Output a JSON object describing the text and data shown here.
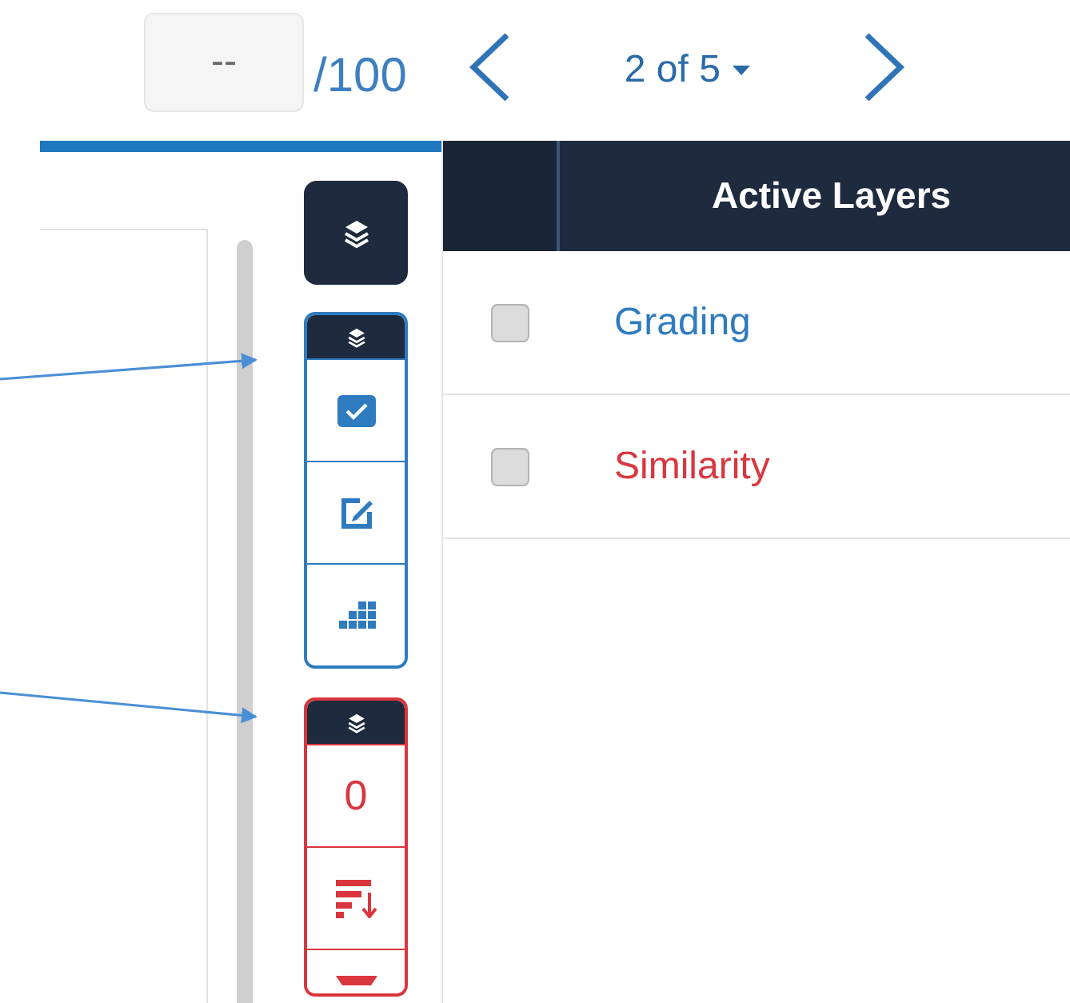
{
  "score": {
    "value": "--",
    "total": "/100"
  },
  "pager": {
    "label": "2 of 5"
  },
  "toolbar": {
    "groups": [
      {
        "color": "#2f7bbf",
        "items": [
          {
            "kind": "check"
          },
          {
            "kind": "edit"
          },
          {
            "kind": "grid"
          }
        ]
      },
      {
        "color": "#d9363e",
        "items": [
          {
            "kind": "count",
            "text": "0"
          },
          {
            "kind": "sort"
          },
          {
            "kind": "funnel"
          }
        ]
      }
    ]
  },
  "layers_table": {
    "columns": [
      "Active Layers"
    ],
    "rows": [
      {
        "name": "Grading",
        "checked": false,
        "color": "#2f7bbf"
      },
      {
        "name": "Similarity",
        "checked": false,
        "color": "#d9363e"
      }
    ]
  }
}
